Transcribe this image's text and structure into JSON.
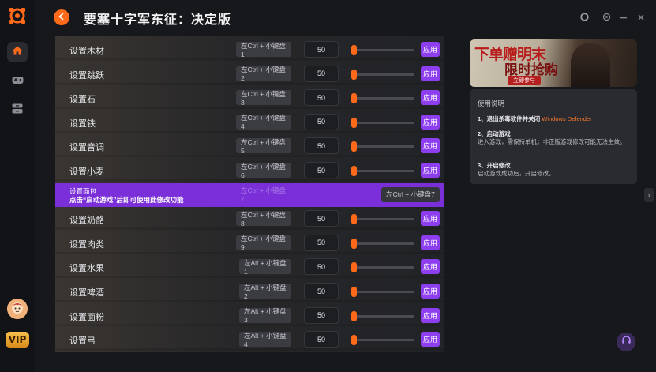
{
  "window": {
    "title": "要塞十字军东征：决定版"
  },
  "sidebar": {
    "items": [
      {
        "name": "home-icon"
      },
      {
        "name": "gamepad-icon"
      },
      {
        "name": "box-icon"
      }
    ],
    "vip_label": "VIP"
  },
  "rows": [
    {
      "label": "设置木材",
      "hotkey": "左Ctrl + 小键盘1",
      "value": "50",
      "apply": "应用"
    },
    {
      "label": "设置跳跃",
      "hotkey": "左Ctrl + 小键盘2",
      "value": "50",
      "apply": "应用"
    },
    {
      "label": "设置石",
      "hotkey": "左Ctrl + 小键盘3",
      "value": "50",
      "apply": "应用"
    },
    {
      "label": "设置铁",
      "hotkey": "左Ctrl + 小键盘4",
      "value": "50",
      "apply": "应用"
    },
    {
      "label": "设置音调",
      "hotkey": "左Ctrl + 小键盘5",
      "value": "50",
      "apply": "应用"
    },
    {
      "label": "设置小麦",
      "hotkey": "左Ctrl + 小键盘6",
      "value": "50",
      "apply": "应用"
    },
    {
      "label": "设置面包",
      "hotkey": "左Ctrl + 小键盘7",
      "hotkey_faded": "左Ctrl + 小键盘7",
      "notice": "点击“启动游戏”后即可使用此修改功能",
      "highlight": true
    },
    {
      "label": "设置奶酪",
      "hotkey": "左Ctrl + 小键盘8",
      "value": "50",
      "apply": "应用"
    },
    {
      "label": "设置肉类",
      "hotkey": "左Ctrl + 小键盘9",
      "value": "50",
      "apply": "应用"
    },
    {
      "label": "设置水果",
      "hotkey": "左Alt + 小键盘1",
      "value": "50",
      "apply": "应用"
    },
    {
      "label": "设置啤酒",
      "hotkey": "左Alt + 小键盘2",
      "value": "50",
      "apply": "应用"
    },
    {
      "label": "设置面粉",
      "hotkey": "左Alt + 小键盘3",
      "value": "50",
      "apply": "应用"
    },
    {
      "label": "设置弓",
      "hotkey": "左Alt + 小键盘4",
      "value": "50",
      "apply": "应用"
    }
  ],
  "banner": {
    "line1": "下单赠明末",
    "line2": "限时抢购",
    "button": "立即参与"
  },
  "info": {
    "heading": "使用说明",
    "step1_title": "1、退出杀毒软件并关闭",
    "step1_highlight": "Windows Defender",
    "step2_title": "2、启动游戏",
    "step2_text": "进入游戏，需保持单机；非正版游戏修改可能无法生效。",
    "step3_title": "3、开启修改",
    "step3_text": "启动游戏成功后，开启修改。"
  },
  "colors": {
    "accent": "#ff6a1a",
    "purple": "#8d3ff0",
    "highlight": "#7a2fd8",
    "background": "#17181c"
  }
}
